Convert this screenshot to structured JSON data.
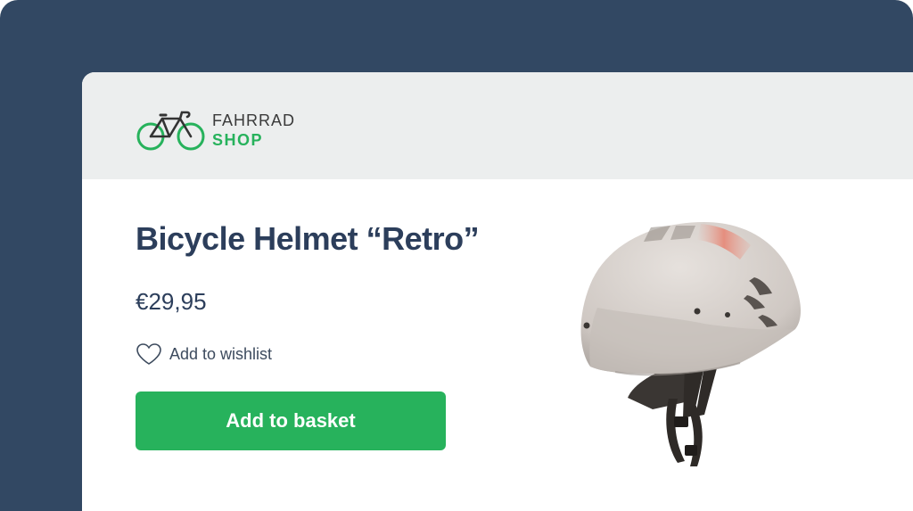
{
  "brand": {
    "name_line1": "FAHRRAD",
    "name_line2": "SHOP",
    "icon": "bicycle-icon",
    "accent_color": "#27b25c"
  },
  "colors": {
    "background": "#324863",
    "header_bg": "#eceeee",
    "text_primary": "#2c3e5b",
    "button_bg": "#27b25c",
    "button_text": "#ffffff"
  },
  "product": {
    "title": "Bicycle Helmet “Retro”",
    "price": "€29,95",
    "image": "bicycle-helmet-image",
    "image_alt": "Bicycle Helmet “Retro”"
  },
  "wishlist": {
    "label": "Add to wishlist",
    "icon": "heart-icon"
  },
  "basket": {
    "label": "Add to basket"
  }
}
